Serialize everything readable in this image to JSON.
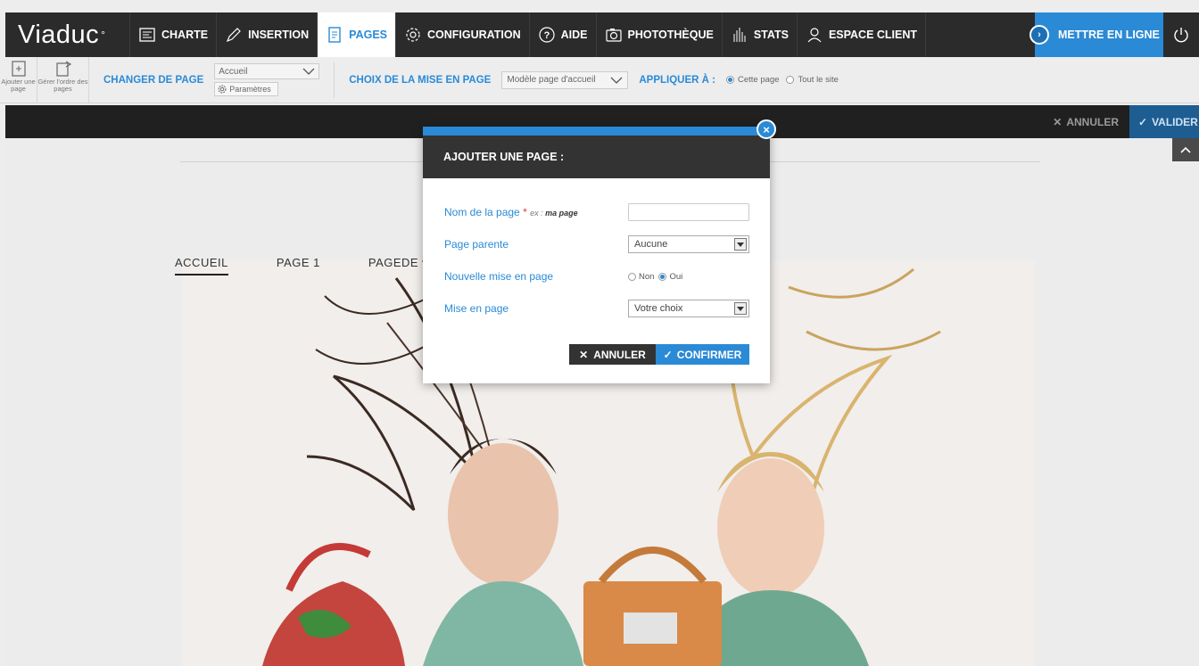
{
  "app": {
    "logo": "Viaduc",
    "logo_mark": "°"
  },
  "nav": {
    "items": [
      {
        "label": "CHARTE",
        "icon": "chart-board-icon"
      },
      {
        "label": "INSERTION",
        "icon": "pencil-icon"
      },
      {
        "label": "PAGES",
        "icon": "pages-icon",
        "active": true
      },
      {
        "label": "CONFIGURATION",
        "icon": "gear-icon"
      },
      {
        "label": "AIDE",
        "icon": "help-icon"
      },
      {
        "label": "PHOTOTHÈQUE",
        "icon": "camera-icon"
      },
      {
        "label": "STATS",
        "icon": "stats-bars-icon"
      },
      {
        "label": "ESPACE CLIENT",
        "icon": "user-icon"
      }
    ],
    "publish_label": "METTRE EN LIGNE",
    "accent": "#2a8ad6"
  },
  "subbar": {
    "add_page": "Ajouter une page",
    "order_pages": "Gérer l'ordre des pages",
    "change_page_label": "CHANGER DE PAGE",
    "current_page": "Accueil",
    "params_label": "Paramètres",
    "layout_choice_label": "CHOIX DE LA MISE EN PAGE",
    "layout_value": "Modèle page d'accueil",
    "apply_label": "APPLIQUER À :",
    "apply_options": [
      "Cette page",
      "Tout le site"
    ],
    "apply_selected": "Cette page"
  },
  "actionbar": {
    "cancel": "ANNULER",
    "validate": "VALIDER"
  },
  "preview": {
    "page_nav": [
      "ACCUEIL",
      "PAGE 1",
      "PAGEDE"
    ],
    "active_page": "ACCUEIL"
  },
  "modal": {
    "title": "AJOUTER UNE PAGE :",
    "fields": {
      "name_label": "Nom de la page",
      "name_required": "*",
      "name_example_prefix": "ex :",
      "name_example_value": "ma page",
      "name_value": "",
      "parent_label": "Page parente",
      "parent_value": "Aucune",
      "new_layout_label": "Nouvelle mise en page",
      "new_layout_options": [
        "Non",
        "Oui"
      ],
      "new_layout_selected": "Oui",
      "layout_label": "Mise en page",
      "layout_value": "Votre choix"
    },
    "cancel": "ANNULER",
    "confirm": "CONFIRMER"
  }
}
